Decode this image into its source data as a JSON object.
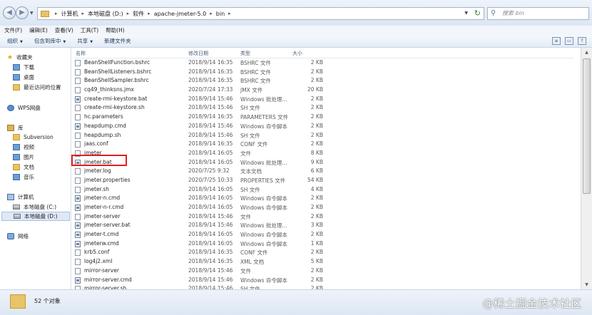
{
  "address": {
    "crumbs": [
      "计算机",
      "本地磁盘 (D:)",
      "软件",
      "apache-jmeter-5.0",
      "bin"
    ],
    "search_placeholder": "搜索 bin"
  },
  "menu": [
    "文件(F)",
    "编辑(E)",
    "查看(V)",
    "工具(T)",
    "帮助(H)"
  ],
  "commands": [
    {
      "label": "组织",
      "dropdown": true
    },
    {
      "label": "包含到库中",
      "dropdown": true
    },
    {
      "label": "共享",
      "dropdown": true
    },
    {
      "label": "新建文件夹",
      "dropdown": false
    }
  ],
  "nav": {
    "favorites": "收藏夹",
    "downloads": "下载",
    "desktop": "桌面",
    "recent": "最近访问的位置",
    "wps": "WPS网盘",
    "libraries": "库",
    "subversion": "Subversion",
    "videos": "视频",
    "pictures": "图片",
    "documents": "文档",
    "music": "音乐",
    "computer": "计算机",
    "drive_c": "本地磁盘 (C:)",
    "drive_d": "本地磁盘 (D:)",
    "network": "网络"
  },
  "columns": {
    "name": "名称",
    "date": "修改日期",
    "type": "类型",
    "size": "大小"
  },
  "files": [
    {
      "name": "BeanShellFunction.bshrc",
      "date": "2018/9/14 16:35",
      "type": "BSHRC 文件",
      "size": "2 KB",
      "icon": "file"
    },
    {
      "name": "BeanShellListeners.bshrc",
      "date": "2018/9/14 16:35",
      "type": "BSHRC 文件",
      "size": "2 KB",
      "icon": "file"
    },
    {
      "name": "BeanShellSampler.bshrc",
      "date": "2018/9/14 16:35",
      "type": "BSHRC 文件",
      "size": "2 KB",
      "icon": "file"
    },
    {
      "name": "cq49_thinksns.jmx",
      "date": "2020/7/24 17:33",
      "type": "JMX 文件",
      "size": "20 KB",
      "icon": "file"
    },
    {
      "name": "create-rmi-keystore.bat",
      "date": "2018/9/14 15:46",
      "type": "Windows 批处理...",
      "size": "2 KB",
      "icon": "bat"
    },
    {
      "name": "create-rmi-keystore.sh",
      "date": "2018/9/14 15:46",
      "type": "SH 文件",
      "size": "2 KB",
      "icon": "file"
    },
    {
      "name": "hc.parameters",
      "date": "2018/9/14 16:35",
      "type": "PARAMETERS 文件",
      "size": "2 KB",
      "icon": "file"
    },
    {
      "name": "heapdump.cmd",
      "date": "2018/9/14 15:46",
      "type": "Windows 命令脚本",
      "size": "2 KB",
      "icon": "bat"
    },
    {
      "name": "heapdump.sh",
      "date": "2018/9/14 15:46",
      "type": "SH 文件",
      "size": "2 KB",
      "icon": "file"
    },
    {
      "name": "jaas.conf",
      "date": "2018/9/14 16:35",
      "type": "CONF 文件",
      "size": "2 KB",
      "icon": "file"
    },
    {
      "name": "jmeter",
      "date": "2018/9/14 16:05",
      "type": "文件",
      "size": "8 KB",
      "icon": "file"
    },
    {
      "name": "jmeter.bat",
      "date": "2018/9/14 16:05",
      "type": "Windows 批处理...",
      "size": "9 KB",
      "icon": "bat"
    },
    {
      "name": "jmeter.log",
      "date": "2020/7/25 9:32",
      "type": "文本文档",
      "size": "6 KB",
      "icon": "file"
    },
    {
      "name": "jmeter.properties",
      "date": "2020/7/25 10:33",
      "type": "PROPERTIES 文件",
      "size": "54 KB",
      "icon": "file"
    },
    {
      "name": "jmeter.sh",
      "date": "2018/9/14 16:05",
      "type": "SH 文件",
      "size": "4 KB",
      "icon": "file"
    },
    {
      "name": "jmeter-n.cmd",
      "date": "2018/9/14 16:05",
      "type": "Windows 命令脚本",
      "size": "2 KB",
      "icon": "bat"
    },
    {
      "name": "jmeter-n-r.cmd",
      "date": "2018/9/14 16:05",
      "type": "Windows 命令脚本",
      "size": "2 KB",
      "icon": "bat"
    },
    {
      "name": "jmeter-server",
      "date": "2018/9/14 15:46",
      "type": "文件",
      "size": "2 KB",
      "icon": "file"
    },
    {
      "name": "jmeter-server.bat",
      "date": "2018/9/14 15:46",
      "type": "Windows 批处理...",
      "size": "3 KB",
      "icon": "bat"
    },
    {
      "name": "jmeter-t.cmd",
      "date": "2018/9/14 16:05",
      "type": "Windows 命令脚本",
      "size": "2 KB",
      "icon": "bat"
    },
    {
      "name": "jmeterw.cmd",
      "date": "2018/9/14 16:05",
      "type": "Windows 命令脚本",
      "size": "1 KB",
      "icon": "bat"
    },
    {
      "name": "krb5.conf",
      "date": "2018/9/14 16:35",
      "type": "CONF 文件",
      "size": "2 KB",
      "icon": "file"
    },
    {
      "name": "log4j2.xml",
      "date": "2018/9/14 16:35",
      "type": "XML 文档",
      "size": "5 KB",
      "icon": "file"
    },
    {
      "name": "mirror-server",
      "date": "2018/9/14 15:46",
      "type": "文件",
      "size": "2 KB",
      "icon": "file"
    },
    {
      "name": "mirror-server.cmd",
      "date": "2018/9/14 15:46",
      "type": "Windows 命令脚本",
      "size": "2 KB",
      "icon": "bat"
    },
    {
      "name": "mirror-server.sh",
      "date": "2018/9/14 15:46",
      "type": "SH 文件",
      "size": "2 KB",
      "icon": "file"
    }
  ],
  "status": {
    "count": "52 个对象"
  },
  "watermark": "@稀土掘金技术社区",
  "colors": {
    "highlight": "#e02020",
    "selection": "#dfe8f6"
  }
}
